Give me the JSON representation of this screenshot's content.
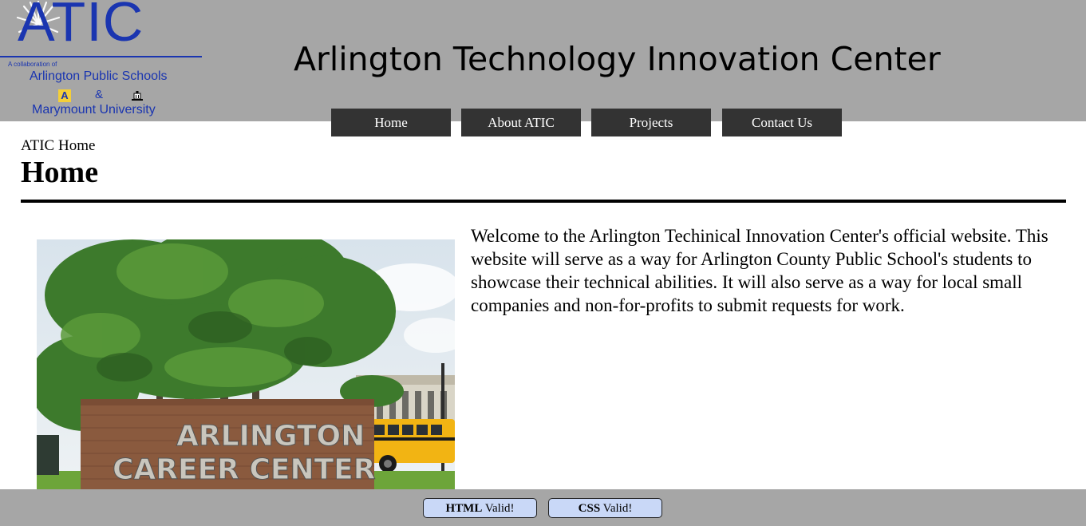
{
  "logo": {
    "wordmark": "ATIC",
    "collab_text": "A collaboration of",
    "school": "Arlington Public Schools",
    "ampersand": "&",
    "school_badge": "A",
    "university": "Marymount University",
    "brand_color": "#1a35b0"
  },
  "header": {
    "title": "Arlington Technology Innovation Center",
    "background": "#a6a6a6"
  },
  "nav": {
    "items": [
      {
        "label": "Home"
      },
      {
        "label": "About ATIC"
      },
      {
        "label": "Projects"
      },
      {
        "label": "Contact Us"
      }
    ],
    "button_color": "#333333"
  },
  "main": {
    "breadcrumb": "ATIC Home",
    "heading": "Home",
    "photo": {
      "sign_line1": "ARLINGTON",
      "sign_line2": "CAREER CENTER"
    },
    "intro": "Welcome to the Arlington Techinical Innovation Center's official website. This website will serve as a way for Arlington County Public School's students to showcase their technical abilities. It will also serve as a way for local small companies and non-for-profits to submit requests for work."
  },
  "footer": {
    "badges": [
      {
        "strong": "HTML",
        "rest": "Valid!"
      },
      {
        "strong": "CSS",
        "rest": "Valid!"
      }
    ],
    "badge_color": "#c9d8f7"
  }
}
